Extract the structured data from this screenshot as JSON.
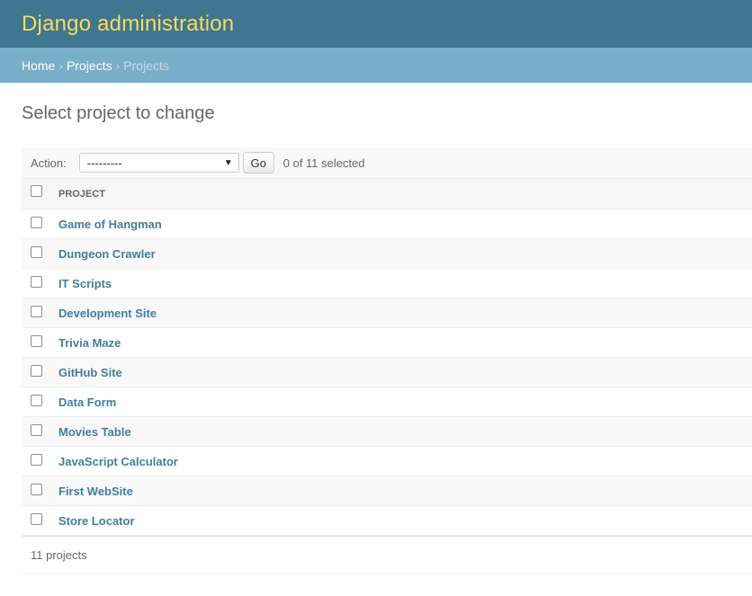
{
  "header": {
    "site_name": "Django administration"
  },
  "breadcrumbs": {
    "home": "Home",
    "section": "Projects",
    "current": "Projects",
    "separator": "›"
  },
  "page": {
    "title": "Select project to change"
  },
  "actions": {
    "label": "Action:",
    "selected_option": "---------",
    "go_label": "Go",
    "counter": "0 of 11 selected"
  },
  "table": {
    "column_header": "PROJECT",
    "rows": [
      "Game of Hangman",
      "Dungeon Crawler",
      "IT Scripts",
      "Development Site",
      "Trivia Maze",
      "GitHub Site",
      "Data Form",
      "Movies Table",
      "JavaScript Calculator",
      "First WebSite",
      "Store Locator"
    ]
  },
  "paginator": {
    "text": "11 projects"
  },
  "colors": {
    "header_bg": "#417690",
    "site_name": "#f5dd5d",
    "breadcrumb_bg": "#79aec8",
    "link": "#447e9b"
  }
}
